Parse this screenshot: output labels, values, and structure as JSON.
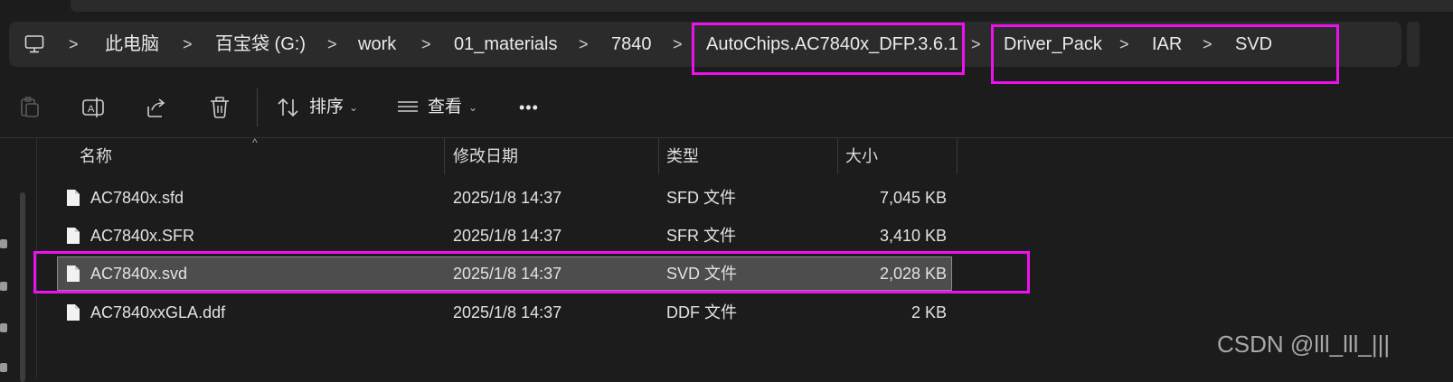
{
  "breadcrumb": {
    "icon": "computer-icon",
    "items": [
      "此电脑",
      "百宝袋 (G:)",
      "work",
      "01_materials",
      "7840",
      "AutoChips.AC7840x_DFP.3.6.1",
      "Driver_Pack",
      "IAR",
      "SVD"
    ],
    "separator": ">"
  },
  "toolbar": {
    "sort_label": "排序",
    "view_label": "查看",
    "more_label": "•••"
  },
  "columns": {
    "name": "名称",
    "date": "修改日期",
    "type": "类型",
    "size": "大小"
  },
  "files": [
    {
      "name": "AC7840x.sfd",
      "date": "2025/1/8 14:37",
      "type": "SFD 文件",
      "size": "7,045 KB"
    },
    {
      "name": "AC7840x.SFR",
      "date": "2025/1/8 14:37",
      "type": "SFR 文件",
      "size": "3,410 KB"
    },
    {
      "name": "AC7840x.svd",
      "date": "2025/1/8 14:37",
      "type": "SVD 文件",
      "size": "2,028 KB",
      "selected": true
    },
    {
      "name": "AC7840xxGLA.ddf",
      "date": "2025/1/8 14:37",
      "type": "DDF 文件",
      "size": "2 KB"
    }
  ],
  "watermark": "CSDN @lll_lll_|||",
  "colors": {
    "highlight": "#ee11ee",
    "background": "#1c1c1c",
    "selected_row": "#4d4d4d"
  }
}
